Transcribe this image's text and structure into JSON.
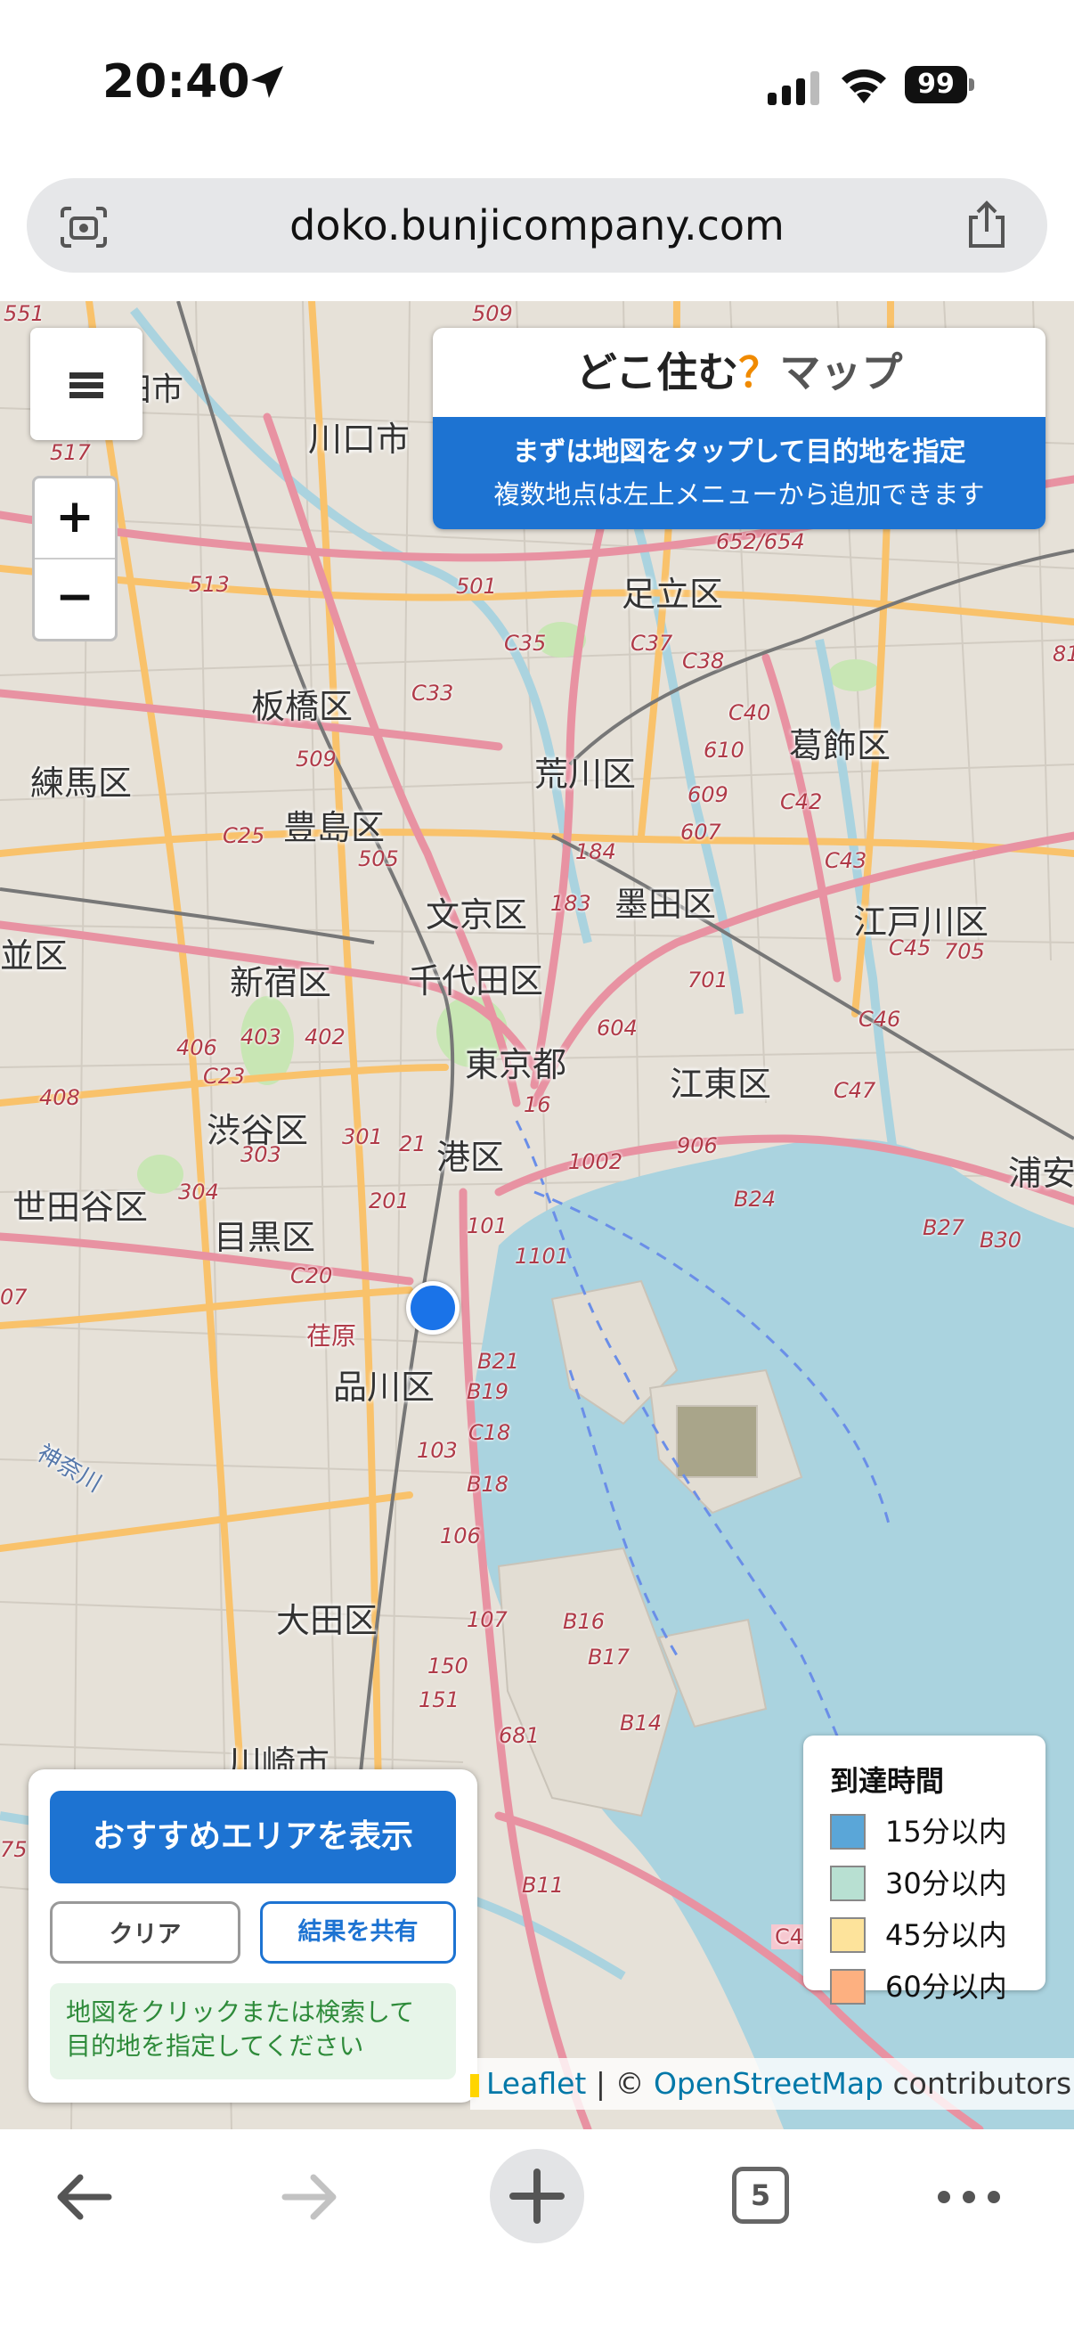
{
  "status_bar": {
    "time": "20:40",
    "battery": "99"
  },
  "browser": {
    "url": "doko.bunjicompany.com",
    "open_tabs": "5"
  },
  "map": {
    "title_main": "どこ住む",
    "title_q": "？",
    "title_map": "マップ",
    "instruction_primary": "まずは地図をタップして目的地を指定",
    "instruction_secondary": "複数地点は左上メニューから追加できます",
    "zoom_in": "+",
    "zoom_out": "−",
    "places": {
      "p1": "戸田市",
      "p2": "川口市",
      "p3": "足立区",
      "p4": "板橋区",
      "p5": "葛飾区",
      "p6": "練馬区",
      "p7": "荒川区",
      "p8": "豊島区",
      "p9": "文京区",
      "p10": "墨田区",
      "p11": "江戸川区",
      "p12": "並区",
      "p13": "新宿区",
      "p14": "千代田区",
      "p15": "東京都",
      "p16": "江東区",
      "p17": "渋谷区",
      "p18": "港区",
      "p19": "浦安",
      "p20": "世田谷区",
      "p21": "目黒区",
      "p22": "品川区",
      "p23": "荏原",
      "p24": "大田区",
      "p25": "川崎市",
      "p26": "神奈川"
    },
    "roads": {
      "r1": "551",
      "r2": "509",
      "r3": "517",
      "r4": "513",
      "r5": "501",
      "r6": "652/654",
      "r7": "C35",
      "r8": "C37",
      "r9": "C38",
      "r10": "C33",
      "r11": "C40",
      "r12": "509",
      "r13": "610",
      "r14": "609",
      "r15": "C42",
      "r16": "607",
      "r17": "C25",
      "r18": "505",
      "r19": "184",
      "r20": "183",
      "r21": "C43",
      "r22": "C45",
      "r23": "705",
      "r24": "701",
      "r25": "406",
      "r26": "403",
      "r27": "402",
      "r28": "C23",
      "r29": "604",
      "r30": "C46",
      "r31": "408",
      "r32": "16",
      "r33": "C47",
      "r34": "303",
      "r35": "301",
      "r36": "21",
      "r37": "1002",
      "r38": "906",
      "r39": "304",
      "r40": "201",
      "r41": "B24",
      "r42": "B27",
      "r43": "B30",
      "r44": "101",
      "r45": "1101",
      "r46": "C20",
      "r47": "B21",
      "r48": "B19",
      "r49": "C18",
      "r50": "103",
      "r51": "B18",
      "r52": "106",
      "r53": "107",
      "r54": "B16",
      "r55": "B17",
      "r56": "150",
      "r57": "151",
      "r58": "B14",
      "r59": "681",
      "r60": "B11",
      "r61": "C4",
      "r62": "81",
      "r63": "07",
      "r64": "75"
    },
    "attribution_leaflet": "Leaflet",
    "attribution_sep": " | © ",
    "attribution_osm": "OpenStreetMap",
    "attribution_tail": " contributors"
  },
  "actions": {
    "recommend": "おすすめエリアを表示",
    "clear": "クリア",
    "share": "結果を共有",
    "hint_line1": "地図をクリックまたは検索して",
    "hint_line2": "目的地を指定してください"
  },
  "legend": {
    "title": "到達時間",
    "items": [
      {
        "label": "15分以内",
        "color": "#5aa6d8"
      },
      {
        "label": "30分以内",
        "color": "#b8e0d2"
      },
      {
        "label": "45分以内",
        "color": "#fde39b"
      },
      {
        "label": "60分以内",
        "color": "#fdb080"
      }
    ]
  },
  "colors": {
    "accent_blue": "#1d73d2",
    "title_q_orange": "#f08a00",
    "water": "#aad3df",
    "marker": "#1a73e8"
  }
}
